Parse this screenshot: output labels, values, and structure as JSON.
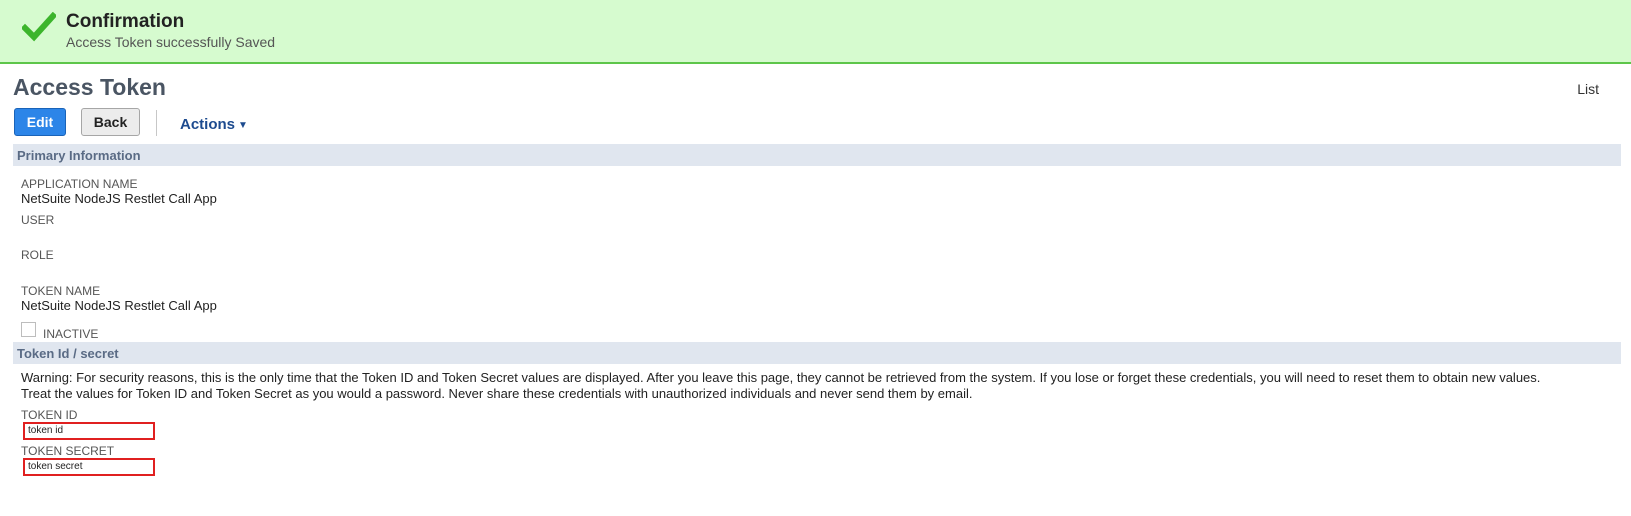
{
  "banner": {
    "title": "Confirmation",
    "message": "Access Token successfully Saved",
    "icon": "checkmark-icon",
    "color": "#d6fbcf"
  },
  "header": {
    "title": "Access Token",
    "list_link": "List"
  },
  "toolbar": {
    "edit_label": "Edit",
    "back_label": "Back",
    "actions_label": "Actions"
  },
  "primary": {
    "section_title": "Primary Information",
    "application_name_label": "APPLICATION NAME",
    "application_name_value": "NetSuite NodeJS Restlet Call App",
    "user_label": "USER",
    "role_label": "ROLE",
    "token_name_label": "TOKEN NAME",
    "token_name_value": "NetSuite NodeJS Restlet Call App",
    "inactive_label": "INACTIVE"
  },
  "token": {
    "section_title": "Token Id / secret",
    "warning_line1": "Warning: For security reasons, this is the only time that the Token ID and Token Secret values are displayed. After you leave this page, they cannot be retrieved from the system. If you lose or forget these credentials, you will need to reset them to obtain new values.",
    "warning_line2": "Treat the values for Token ID and Token Secret as you would a password. Never share these credentials with unauthorized individuals and never send them by email.",
    "token_id_label": "TOKEN ID",
    "token_id_value": "token id",
    "token_secret_label": "TOKEN SECRET",
    "token_secret_value": "token secret"
  }
}
